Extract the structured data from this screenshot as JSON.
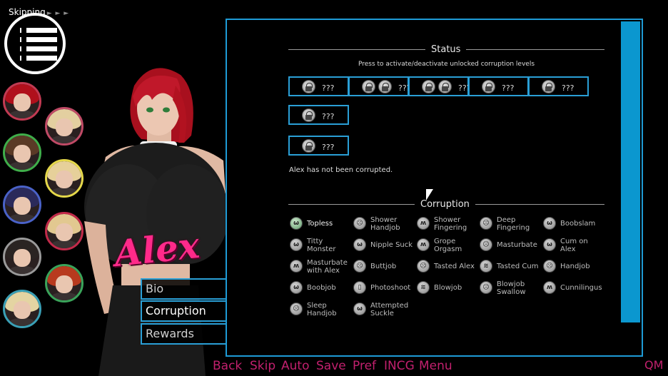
{
  "skip_indicator": {
    "label": "Skipping",
    "arrows": "► ► ►"
  },
  "character_name": "Alex",
  "side_tabs": [
    {
      "label": "Bio",
      "active": false
    },
    {
      "label": "Corruption",
      "active": true
    },
    {
      "label": "Rewards",
      "active": false
    }
  ],
  "status": {
    "title": "Status",
    "hint": "Press to activate/deactivate unlocked corruption levels",
    "slots_row1": [
      {
        "label": "???",
        "locks": 1
      },
      {
        "label": "???",
        "locks": 2
      },
      {
        "label": "???",
        "locks": 2
      },
      {
        "label": "???",
        "locks": 1
      },
      {
        "label": "???",
        "locks": 1
      }
    ],
    "slots_extra": [
      {
        "label": "???",
        "locks": 1
      },
      {
        "label": "???",
        "locks": 1
      }
    ],
    "message": "Alex has not been corrupted."
  },
  "corruption": {
    "title": "Corruption",
    "items": [
      {
        "label": "Topless",
        "icon": "breasts-icon",
        "active": true
      },
      {
        "label": "Shower\nHandjob",
        "icon": "face-icon",
        "active": false
      },
      {
        "label": "Shower\nFingering",
        "icon": "hand-icon",
        "active": false
      },
      {
        "label": "Deep\nFingering",
        "icon": "face-icon",
        "active": false
      },
      {
        "label": "Boobslam",
        "icon": "breasts-icon",
        "active": false
      },
      {
        "label": "Titty\nMonster",
        "icon": "breasts-icon",
        "active": false
      },
      {
        "label": "Nipple Suck",
        "icon": "breasts-icon",
        "active": false
      },
      {
        "label": "Grope\nOrgasm",
        "icon": "hand-icon",
        "active": false
      },
      {
        "label": "Masturbate",
        "icon": "face-icon",
        "active": false
      },
      {
        "label": "Cum on\nAlex",
        "icon": "breasts-icon",
        "active": false
      },
      {
        "label": "Masturbate\nwith Alex",
        "icon": "hand-icon",
        "active": false
      },
      {
        "label": "Buttjob",
        "icon": "face-icon",
        "active": false
      },
      {
        "label": "Tasted Alex",
        "icon": "face-icon",
        "active": false
      },
      {
        "label": "Tasted Cum",
        "icon": "lips-icon",
        "active": false
      },
      {
        "label": "Handjob",
        "icon": "face-icon",
        "active": false
      },
      {
        "label": "Boobjob",
        "icon": "breasts-icon",
        "active": false
      },
      {
        "label": "Photoshoot",
        "icon": "phone-icon",
        "active": false
      },
      {
        "label": "Blowjob",
        "icon": "lips-icon",
        "active": false
      },
      {
        "label": "Blowjob\nSwallow",
        "icon": "face-icon",
        "active": false
      },
      {
        "label": "Cunnilingus",
        "icon": "hand-icon",
        "active": false
      },
      {
        "label": "Sleep\nHandjob",
        "icon": "face-icon",
        "active": false
      },
      {
        "label": "Attempted\nSuckle",
        "icon": "breasts-icon",
        "active": false
      }
    ]
  },
  "quick_menu": [
    "Back",
    "Skip",
    "Auto",
    "Save",
    "Pref",
    "INCG",
    "Menu"
  ],
  "quick_menu_corner": "QM",
  "colors": {
    "accent": "#1e9bd6",
    "quick_menu": "#c2206e",
    "name_logo": "#ff2a8a"
  },
  "portraits": [
    {
      "hair": "#b0101c",
      "ring": "#c23a52"
    },
    {
      "hair": "#e3cfa0",
      "ring": "#c04a66"
    },
    {
      "hair": "#5a3a26",
      "ring": "#3fae4a"
    },
    {
      "hair": "#e6d09a",
      "ring": "#e5d84a"
    },
    {
      "hair": "#2b2a5a",
      "ring": "#4a62c8"
    },
    {
      "hair": "#e2c890",
      "ring": "#c22a4a"
    },
    {
      "hair": "#2a2422",
      "ring": "#9a9a9a"
    },
    {
      "hair": "#b83a1e",
      "ring": "#3aa45a"
    },
    {
      "hair": "#e4d4a2",
      "ring": "#3aa0b6"
    }
  ]
}
